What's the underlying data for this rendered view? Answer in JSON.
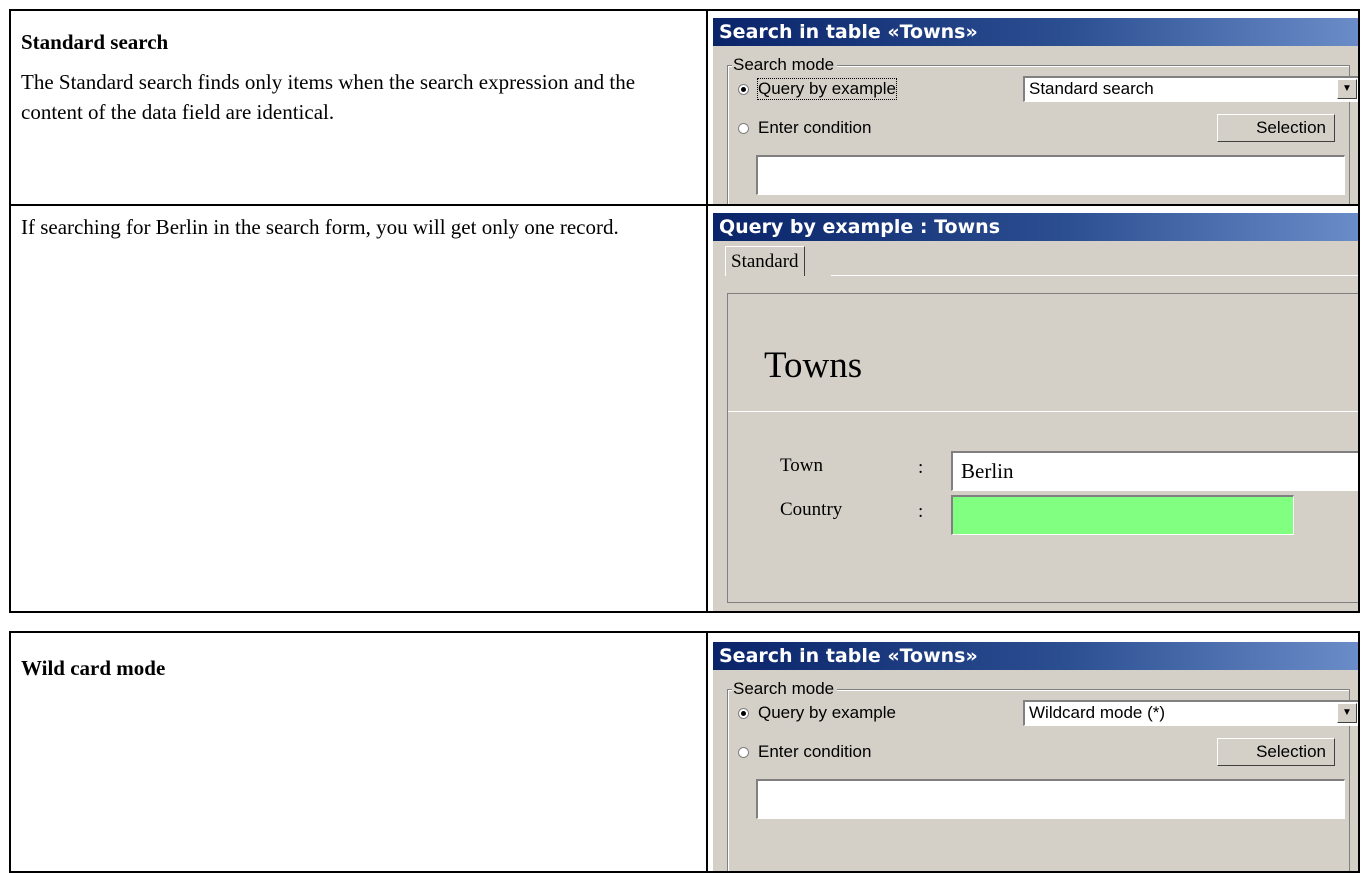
{
  "rows": [
    {
      "heading": "Standard search",
      "text": "The Standard search finds only items when the search expression and the content of the data field are identical.",
      "dialog": {
        "title": "Search in table «Towns»",
        "group_label": "Search mode",
        "radio_qbe": "Query by example",
        "radio_cond": "Enter condition",
        "combo_value": "Standard search",
        "selection_button": "Selection"
      }
    },
    {
      "text": "If searching for Berlin in the search form, you will get only one record.",
      "qbe": {
        "title": "Query by example : Towns",
        "tab": "Standard",
        "form_title": "Towns",
        "town_label": "Town",
        "town_colon": ":",
        "town_value": "Berlin",
        "country_label": "Country",
        "country_colon": ":",
        "country_value": "",
        "country_color": "#80ff80"
      }
    }
  ],
  "second_table": {
    "heading": "Wild card mode",
    "dialog": {
      "title": "Search in table «Towns»",
      "group_label": "Search mode",
      "radio_qbe": "Query by example",
      "radio_cond": "Enter condition",
      "combo_value": "Wildcard mode (*)",
      "selection_button": "Selection"
    }
  },
  "icons": {
    "dropdown_arrow": "triangle-down-icon",
    "radio": "radio-button-icon"
  }
}
